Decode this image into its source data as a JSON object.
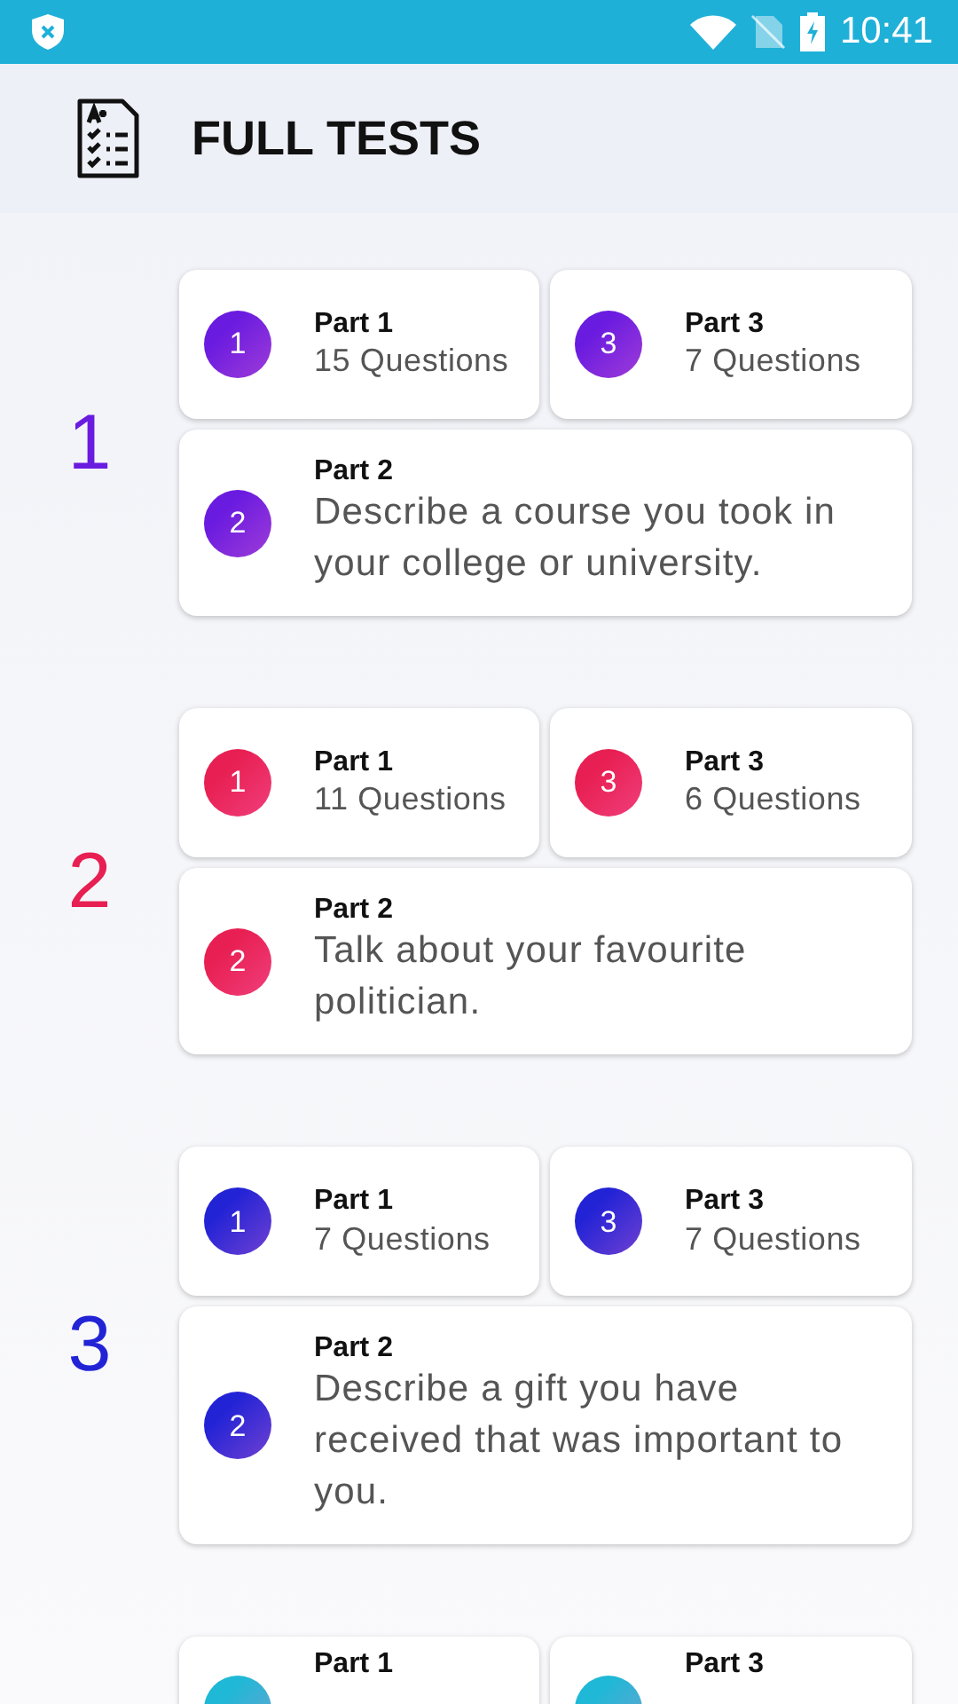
{
  "status_bar": {
    "time": "10:41"
  },
  "header": {
    "title": "FULL TESTS"
  },
  "tests": [
    {
      "number": "1",
      "color": "#6a1be0",
      "parts": [
        {
          "kind": "short",
          "circle": "1",
          "title": "Part 1",
          "text": "15 Questions"
        },
        {
          "kind": "short",
          "circle": "3",
          "title": "Part 3",
          "text": "7 Questions"
        },
        {
          "kind": "wide",
          "circle": "2",
          "title": "Part 2",
          "text": "Describe a course you took in your college or university."
        }
      ]
    },
    {
      "number": "2",
      "color": "#e81f52",
      "parts": [
        {
          "kind": "short",
          "circle": "1",
          "title": "Part 1",
          "text": "11 Questions"
        },
        {
          "kind": "short",
          "circle": "3",
          "title": "Part 3",
          "text": "6 Questions"
        },
        {
          "kind": "wide",
          "circle": "2",
          "title": "Part 2",
          "text": "Talk about your favourite politician."
        }
      ]
    },
    {
      "number": "3",
      "color": "#2323d6",
      "parts": [
        {
          "kind": "short",
          "circle": "1",
          "title": "Part 1",
          "text": "7 Questions"
        },
        {
          "kind": "short",
          "circle": "3",
          "title": "Part 3",
          "text": "7 Questions"
        },
        {
          "kind": "wide",
          "circle": "2",
          "title": "Part 2",
          "text": "Describe a gift you have received that was important to you."
        }
      ]
    },
    {
      "color": "#1fb8d6",
      "parts": [
        {
          "kind": "short",
          "title": "Part 1"
        },
        {
          "kind": "short",
          "title": "Part 3"
        }
      ]
    }
  ]
}
